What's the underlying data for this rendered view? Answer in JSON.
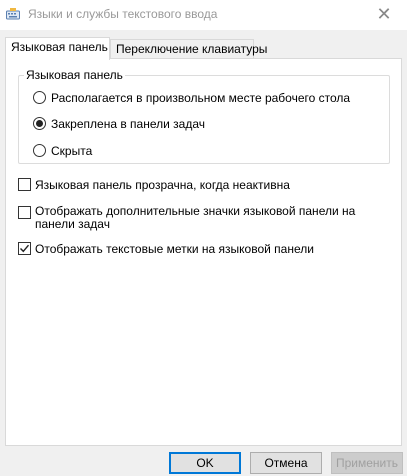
{
  "window": {
    "title": "Языки и службы текстового ввода",
    "close_glyph": "✕"
  },
  "tabs": [
    {
      "label": "Языковая панель",
      "active": true
    },
    {
      "label": "Переключение клавиатуры",
      "active": false
    }
  ],
  "language_bar": {
    "group_label": "Языковая панель",
    "options": [
      {
        "label": "Располагается в произвольном месте рабочего стола",
        "checked": false
      },
      {
        "label": "Закреплена в панели задач",
        "checked": true
      },
      {
        "label": "Скрыта",
        "checked": false
      }
    ]
  },
  "checkboxes": [
    {
      "label": "Языковая панель прозрачна, когда неактивна",
      "checked": false
    },
    {
      "label": "Отображать дополнительные значки языковой панели на панели задач",
      "checked": false
    },
    {
      "label": "Отображать текстовые метки на языковой панели",
      "checked": true
    }
  ],
  "buttons": {
    "ok": "OK",
    "cancel": "Отмена",
    "apply": "Применить"
  }
}
